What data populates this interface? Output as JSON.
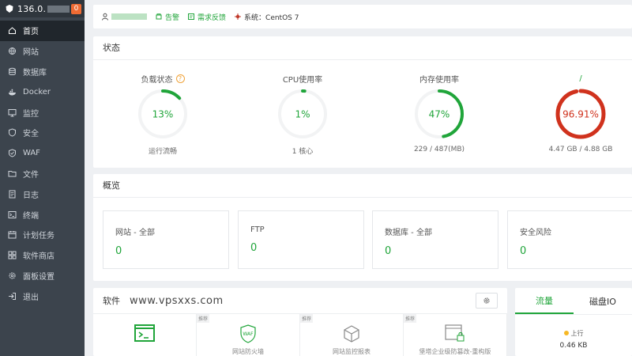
{
  "sidebar": {
    "ip": "136.0.",
    "badge": "0",
    "items": [
      {
        "label": "首页",
        "icon": "home-icon",
        "active": true
      },
      {
        "label": "网站",
        "icon": "globe-icon"
      },
      {
        "label": "数据库",
        "icon": "database-icon"
      },
      {
        "label": "Docker",
        "icon": "docker-icon"
      },
      {
        "label": "监控",
        "icon": "monitor-icon"
      },
      {
        "label": "安全",
        "icon": "shield-icon"
      },
      {
        "label": "WAF",
        "icon": "waf-shield-icon"
      },
      {
        "label": "文件",
        "icon": "folder-icon"
      },
      {
        "label": "日志",
        "icon": "log-icon"
      },
      {
        "label": "终端",
        "icon": "terminal-icon"
      },
      {
        "label": "计划任务",
        "icon": "calendar-icon"
      },
      {
        "label": "软件商店",
        "icon": "apps-icon"
      },
      {
        "label": "面板设置",
        "icon": "settings-icon"
      },
      {
        "label": "退出",
        "icon": "logout-icon"
      }
    ]
  },
  "infobar": {
    "alert": "告警",
    "feedback": "需求反馈",
    "system": "系统：CentOS 7"
  },
  "status": {
    "title": "状态",
    "gauges": [
      {
        "title": "负载状态",
        "value": "13%",
        "percent": 13,
        "sub": "运行流畅",
        "color": "#20a53a"
      },
      {
        "title": "CPU使用率",
        "value": "1%",
        "percent": 1,
        "sub": "1 核心",
        "color": "#20a53a"
      },
      {
        "title": "内存使用率",
        "value": "47%",
        "percent": 47,
        "sub": "229 / 487(MB)",
        "color": "#20a53a"
      },
      {
        "title": "/",
        "value": "96.91%",
        "percent": 96.91,
        "sub": "4.47 GB / 4.88 GB",
        "color": "#d0321d"
      }
    ]
  },
  "overview": {
    "title": "概览",
    "boxes": [
      {
        "label": "网站 - 全部",
        "value": "0"
      },
      {
        "label": "FTP",
        "value": "0"
      },
      {
        "label": "数据库 - 全部",
        "value": "0"
      },
      {
        "label": "安全风险",
        "value": "0"
      }
    ]
  },
  "software": {
    "title": "软件",
    "watermark": "www.vpsxxs.com",
    "items": [
      {
        "name": "",
        "tag": ""
      },
      {
        "name": "网站防火墙",
        "tag": "推荐"
      },
      {
        "name": "网站监控报表",
        "tag": "推荐"
      },
      {
        "name": "堡塔企业级防篡改-重构版",
        "tag": "推荐"
      }
    ]
  },
  "traffic": {
    "tabs": [
      "流量",
      "磁盘IO"
    ],
    "up_label": "上行",
    "up_value": "0.46 KB"
  },
  "colors": {
    "accent": "#20a53a",
    "danger": "#d0321d",
    "sidebar_bg": "#3c444d"
  }
}
